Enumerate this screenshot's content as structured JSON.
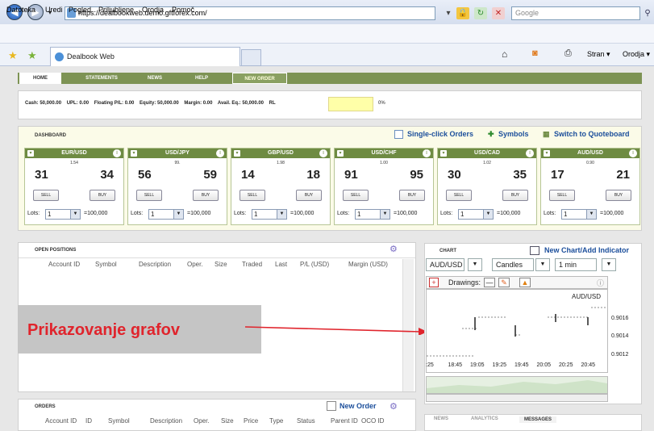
{
  "browser": {
    "url": "https://dealbookweb.demo.gftforex.com/",
    "search_placeholder": "Google",
    "menu": [
      "Datoteka",
      "Uredi",
      "Pogled",
      "Priljubljene",
      "Orodja",
      "Pomoč"
    ],
    "tab_title": "Dealbook Web",
    "right_tools": [
      "Stran ▾",
      "Orodja ▾"
    ]
  },
  "nav": {
    "items": [
      "HOME",
      "STATEMENTS",
      "NEWS",
      "HELP",
      "NEW ORDER"
    ]
  },
  "stats": {
    "text": "Cash: 50,000.00    UPL: 0.00    Floating P/L: 0.00    Equity: 50,000.00    Margin: 0.00    Avail. Eq.: 50,000.00    RL",
    "pct": "0%"
  },
  "dashboard": {
    "title": "DASHBOARD",
    "links": [
      "Single-click Orders",
      "Symbols",
      "Switch to Quoteboard"
    ],
    "tiles": [
      {
        "pair": "EUR/USD",
        "spread": "1.54",
        "bid": "31",
        "ask": "34"
      },
      {
        "pair": "USD/JPY",
        "spread": "99.",
        "bid": "56",
        "ask": "59"
      },
      {
        "pair": "GBP/USD",
        "spread": "1.98",
        "bid": "14",
        "ask": "18"
      },
      {
        "pair": "USD/CHF",
        "spread": "1.00",
        "bid": "91",
        "ask": "95"
      },
      {
        "pair": "USD/CAD",
        "spread": "1.02",
        "bid": "30",
        "ask": "35"
      },
      {
        "pair": "AUD/USD",
        "spread": "0.90",
        "bid": "17",
        "ask": "21"
      }
    ],
    "sell": "SELL",
    "buy": "BUY",
    "lots_label": "Lots:",
    "lots_value": "1",
    "lot_size": "=100,000"
  },
  "positions": {
    "title": "OPEN POSITIONS",
    "columns": [
      "Account ID",
      "Symbol",
      "Description",
      "Oper.",
      "Size",
      "Traded",
      "Last",
      "P/L (USD)",
      "Margin (USD)"
    ]
  },
  "orders": {
    "title": "ORDERS",
    "new_order": "New Order",
    "columns": [
      "Account ID",
      "ID",
      "Symbol",
      "Description",
      "Oper.",
      "Size",
      "Price",
      "Type",
      "Status",
      "Parent ID",
      "OCO ID"
    ]
  },
  "overlay_label": "Prikazovanje grafov",
  "chart": {
    "title": "CHART",
    "new_chart_link": "New Chart/Add Indicator",
    "symbol": "AUD/USD",
    "type": "Candles",
    "interval": "1 min",
    "drawings": "Drawings:",
    "pair_label": "AUD/USD",
    "yticks": [
      "0.9016",
      "0.9014",
      "0.9012"
    ],
    "xticks": [
      ":25",
      "18:45",
      "19:05",
      "19:25",
      "19:45",
      "20:05",
      "20:25",
      "20:45"
    ]
  },
  "bottom_tabs": [
    "NEWS",
    "ANALYTICS",
    "MESSAGES"
  ],
  "colors": {
    "nav": "#7d9354",
    "tile_header": "#6e8b42",
    "link": "#1b4e9b",
    "overlay_text": "#e0242c"
  }
}
